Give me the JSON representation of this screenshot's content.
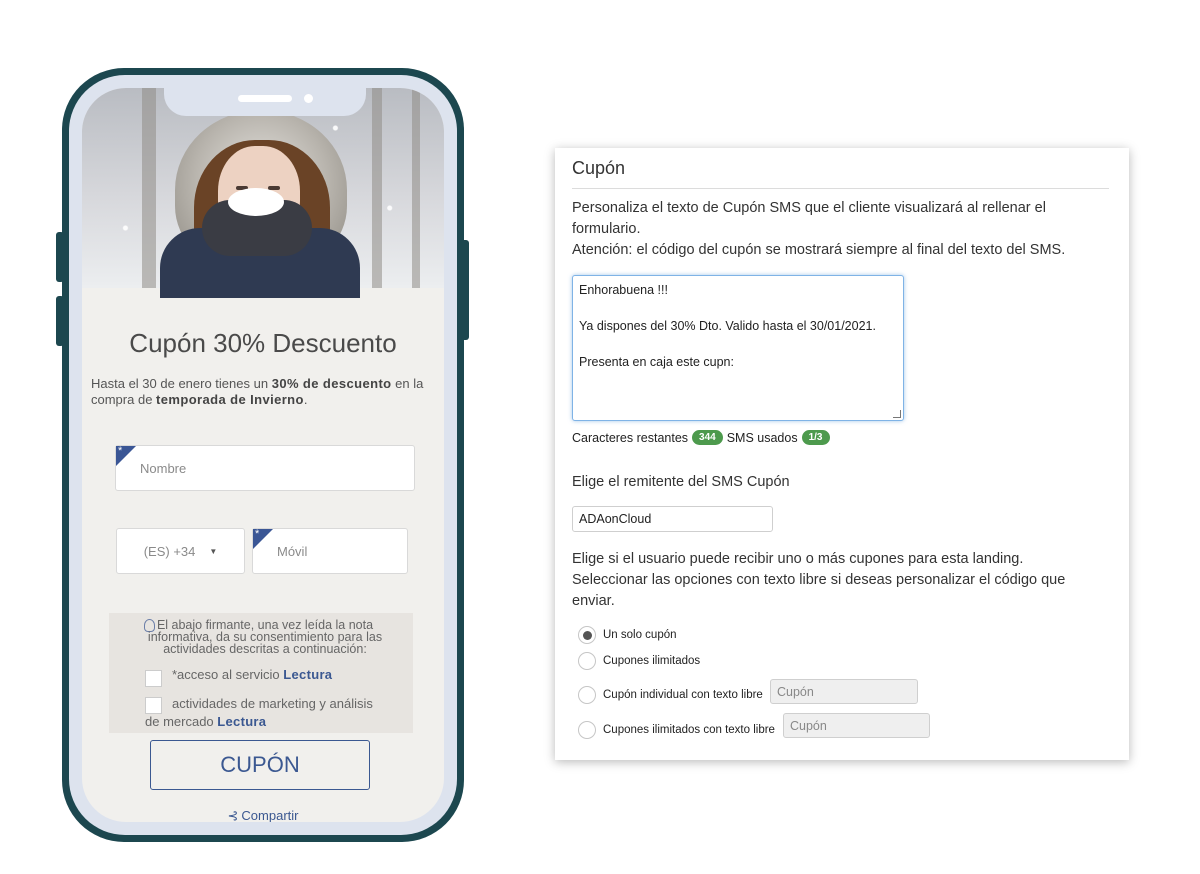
{
  "mobile": {
    "promo_title": "Cupón 30% Descuento",
    "promo_text_1": "Hasta el 30 de enero tienes un ",
    "promo_bold_1": "30% de descuento",
    "promo_text_2": " en la compra de ",
    "promo_bold_2": "temporada de Invierno",
    "promo_text_3": ".",
    "name_placeholder": "Nombre",
    "country_code": "(ES) +34",
    "mobile_placeholder": "Móvil",
    "consent_text": "El abajo firmante, una vez leída la nota informativa, da su consentimiento para las actividades descritas a continuación:",
    "check1_text": "*acceso al servicio ",
    "check1_link": "Lectura",
    "check2_text": "actividades de marketing y análisis de mercado ",
    "check2_link": "Lectura",
    "button_label": "CUPÓN",
    "share_label": "Compartir"
  },
  "panel": {
    "title": "Cupón",
    "intro_1": "Personaliza el texto de Cupón SMS que el cliente visualizará al rellenar el formulario.",
    "intro_2": "Atención: el código del cupón se mostrará siempre al final del texto del SMS.",
    "sms_lines": [
      "Enhorabuena !!!",
      "",
      "Ya dispones del 30% Dto. Valido hasta el 30/01/2021.",
      "",
      "Presenta en caja este cupn:"
    ],
    "remaining_label": "Caracteres restantes",
    "remaining_count": "344",
    "sms_used_label": "SMS usados",
    "sms_used_count": "1/3",
    "sender_heading": "Elige el remitente del SMS Cupón",
    "sender_value": "ADAonCloud",
    "options_text_1": "Elige si el usuario puede recibir uno o más cupones para esta landing.",
    "options_text_2": "Seleccionar las opciones con texto libre si deseas personalizar el código que enviar.",
    "options": [
      {
        "label": "Un solo cupón",
        "selected": true
      },
      {
        "label": "Cupones ilimitados",
        "selected": false
      },
      {
        "label": "Cupón individual con texto libre",
        "selected": false,
        "placeholder": "Cupón"
      },
      {
        "label": "Cupones ilimitados con texto libre",
        "selected": false,
        "placeholder": "Cupón"
      }
    ]
  },
  "colors": {
    "phone_frame": "#1c474f",
    "brand_blue": "#3b5891",
    "badge_green": "#4d9a4d"
  }
}
